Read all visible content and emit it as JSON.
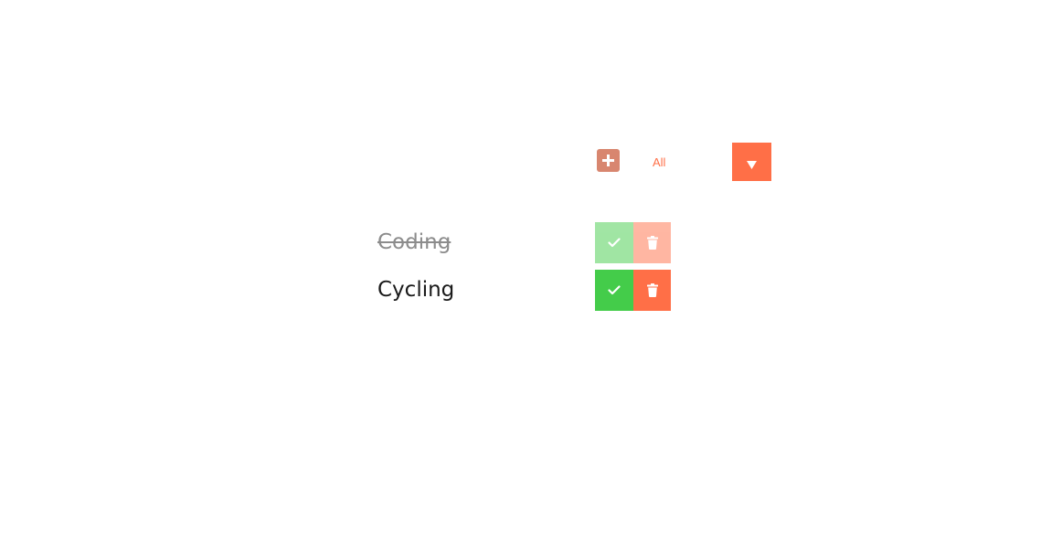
{
  "toolbar": {
    "add_icon": "plus-icon",
    "filter": {
      "selected": "All",
      "arrow_icon": "triangle-down-icon"
    }
  },
  "todos": [
    {
      "text": "Coding",
      "completed": true
    },
    {
      "text": "Cycling",
      "completed": false
    }
  ],
  "icons": {
    "complete": "check-icon",
    "delete": "trash-icon"
  },
  "colors": {
    "accent": "#ff6f47",
    "add_button": "#d8866f",
    "complete": "#44cc4a",
    "background": "#ffffff"
  }
}
